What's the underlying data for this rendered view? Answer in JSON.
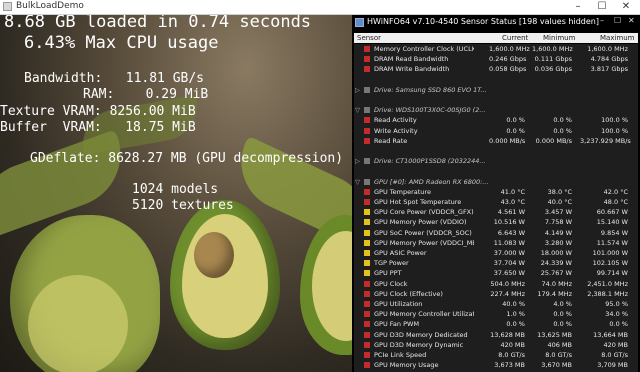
{
  "window": {
    "title": "BulkLoadDemo",
    "minimize": "–",
    "maximize": "☐",
    "close": "✕"
  },
  "overlay": {
    "line1": "8.68 GB loaded in 0.74 seconds",
    "line2": "6.43% Max CPU usage",
    "bandwidth": "Bandwidth:   11.81 GB/s",
    "ram": "RAM:    0.29 MiB",
    "texture_vram": "Texture VRAM: 8256.00 MiB",
    "buffer_vram": "Buffer  VRAM:   18.75 MiB",
    "gdeflate": "GDeflate: 8628.27 MB (GPU decompression)",
    "models": "1024 models",
    "textures": "5120 textures"
  },
  "hwinfo": {
    "title": "HWiNFO64 v7.10-4540 Sensor Status [198 values hidden]",
    "columns": {
      "sensor": "Sensor",
      "current": "Current",
      "minimum": "Minimum",
      "maximum": "Maximum"
    },
    "rows": [
      {
        "type": "item",
        "name": "Memory Controller Clock (UCLK)",
        "current": "1,600.0 MHz",
        "minimum": "1,600.0 MHz",
        "maximum": "1,600.0 MHz",
        "icon": "red"
      },
      {
        "type": "item",
        "name": "DRAM Read Bandwidth",
        "current": "0.246 Gbps",
        "minimum": "0.111 Gbps",
        "maximum": "4.784 Gbps",
        "icon": "red"
      },
      {
        "type": "item",
        "name": "DRAM Write Bandwidth",
        "current": "0.058 Gbps",
        "minimum": "0.036 Gbps",
        "maximum": "3.817 Gbps",
        "icon": "red"
      },
      {
        "type": "blank"
      },
      {
        "type": "group",
        "name": "Drive: Samsung SSD 860 EVO 1T...",
        "exp": "▷"
      },
      {
        "type": "blank"
      },
      {
        "type": "group",
        "name": "Drive: WDS100T3X0C-00SJG0 (2...",
        "exp": "▽"
      },
      {
        "type": "item",
        "name": "Read Activity",
        "current": "0.0 %",
        "minimum": "0.0 %",
        "maximum": "100.0 %",
        "icon": "red"
      },
      {
        "type": "item",
        "name": "Write Activity",
        "current": "0.0 %",
        "minimum": "0.0 %",
        "maximum": "100.0 %",
        "icon": "red"
      },
      {
        "type": "item",
        "name": "Read Rate",
        "current": "0.000 MB/s",
        "minimum": "0.000 MB/s",
        "maximum": "3,237.929 MB/s",
        "icon": "red"
      },
      {
        "type": "blank"
      },
      {
        "type": "group",
        "name": "Drive: CT1000P1SSD8 (2032244...",
        "exp": "▷"
      },
      {
        "type": "blank"
      },
      {
        "type": "group",
        "name": "GPU [#0]: AMD Radeon RX 6800:...",
        "exp": "▽"
      },
      {
        "type": "item",
        "name": "GPU Temperature",
        "current": "41.0 °C",
        "minimum": "38.0 °C",
        "maximum": "42.0 °C",
        "icon": "red"
      },
      {
        "type": "item",
        "name": "GPU Hot Spot Temperature",
        "current": "43.0 °C",
        "minimum": "40.0 °C",
        "maximum": "48.0 °C",
        "icon": "red"
      },
      {
        "type": "item",
        "name": "GPU Core Power (VDDCR_GFX)",
        "current": "4.561 W",
        "minimum": "3.457 W",
        "maximum": "60.667 W",
        "icon": "yellow"
      },
      {
        "type": "item",
        "name": "GPU Memory Power (VDDIO)",
        "current": "10.516 W",
        "minimum": "7.758 W",
        "maximum": "15.140 W",
        "icon": "yellow"
      },
      {
        "type": "item",
        "name": "GPU SoC Power (VDDCR_SOC)",
        "current": "6.643 W",
        "minimum": "4.149 W",
        "maximum": "9.854 W",
        "icon": "yellow"
      },
      {
        "type": "item",
        "name": "GPU Memory Power (VDDCI_MEM)",
        "current": "11.083 W",
        "minimum": "3.280 W",
        "maximum": "11.574 W",
        "icon": "yellow"
      },
      {
        "type": "item",
        "name": "GPU ASIC Power",
        "current": "37.000 W",
        "minimum": "18.000 W",
        "maximum": "101.000 W",
        "icon": "yellow"
      },
      {
        "type": "item",
        "name": "TGP Power",
        "current": "37.704 W",
        "minimum": "24.339 W",
        "maximum": "102.105 W",
        "icon": "yellow"
      },
      {
        "type": "item",
        "name": "GPU PPT",
        "current": "37.650 W",
        "minimum": "25.767 W",
        "maximum": "99.714 W",
        "icon": "yellow"
      },
      {
        "type": "item",
        "name": "GPU Clock",
        "current": "504.0 MHz",
        "minimum": "74.0 MHz",
        "maximum": "2,451.0 MHz",
        "icon": "red"
      },
      {
        "type": "item",
        "name": "GPU Clock (Effective)",
        "current": "227.4 MHz",
        "minimum": "179.4 MHz",
        "maximum": "2,388.1 MHz",
        "icon": "red"
      },
      {
        "type": "item",
        "name": "GPU Utilization",
        "current": "40.0 %",
        "minimum": "4.0 %",
        "maximum": "95.0 %",
        "icon": "red"
      },
      {
        "type": "item",
        "name": "GPU Memory Controller Utilization",
        "current": "1.0 %",
        "minimum": "0.0 %",
        "maximum": "34.0 %",
        "icon": "red"
      },
      {
        "type": "item",
        "name": "GPU Fan PWM",
        "current": "0.0 %",
        "minimum": "0.0 %",
        "maximum": "0.0 %",
        "icon": "red"
      },
      {
        "type": "item",
        "name": "GPU D3D Memory Dedicated",
        "current": "13,628 MB",
        "minimum": "13,625 MB",
        "maximum": "13,664 MB",
        "icon": "red"
      },
      {
        "type": "item",
        "name": "GPU D3D Memory Dynamic",
        "current": "420 MB",
        "minimum": "406 MB",
        "maximum": "420 MB",
        "icon": "red"
      },
      {
        "type": "item",
        "name": "PCIe Link Speed",
        "current": "8.0 GT/s",
        "minimum": "8.0 GT/s",
        "maximum": "8.0 GT/s",
        "icon": "red"
      },
      {
        "type": "item",
        "name": "GPU Memory Usage",
        "current": "3,673 MB",
        "minimum": "3,670 MB",
        "maximum": "3,709 MB",
        "icon": "red"
      }
    ]
  }
}
